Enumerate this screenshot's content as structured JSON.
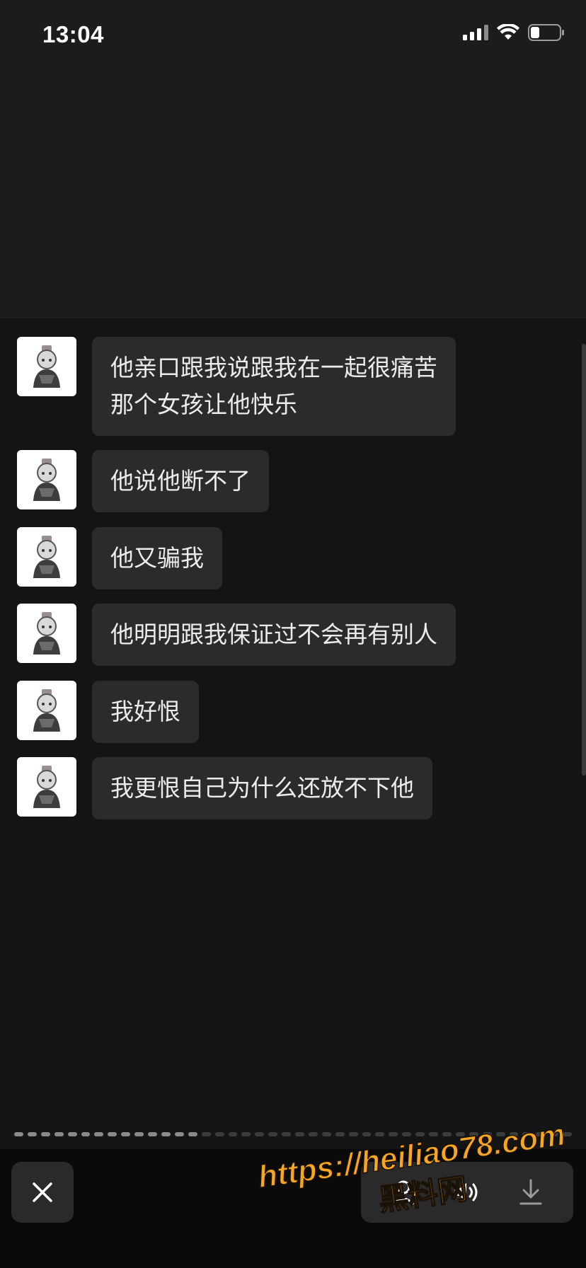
{
  "status_bar": {
    "time": "13:04"
  },
  "messages": [
    {
      "lines": [
        "他亲口跟我说跟我在一起很痛苦",
        "那个女孩让他快乐"
      ]
    },
    {
      "lines": [
        "他说他断不了"
      ]
    },
    {
      "lines": [
        "他又骗我"
      ]
    },
    {
      "lines": [
        "他明明跟我保证过不会再有别人"
      ]
    },
    {
      "lines": [
        "我好恨"
      ]
    },
    {
      "lines": [
        "我更恨自己为什么还放不下他"
      ]
    }
  ],
  "progress": {
    "segments_total": 42,
    "segments_done": 14
  },
  "bottom_bar": {
    "close_icon": "close-icon",
    "actions": [
      "avatar-icon",
      "speaker-icon",
      "download-icon"
    ]
  },
  "watermark": {
    "url": "https://heiliao78.com",
    "name": "黑料网"
  },
  "colors": {
    "background": "#1c1c1c",
    "bubble": "#2b2b2b",
    "watermark": "#f5a623"
  }
}
